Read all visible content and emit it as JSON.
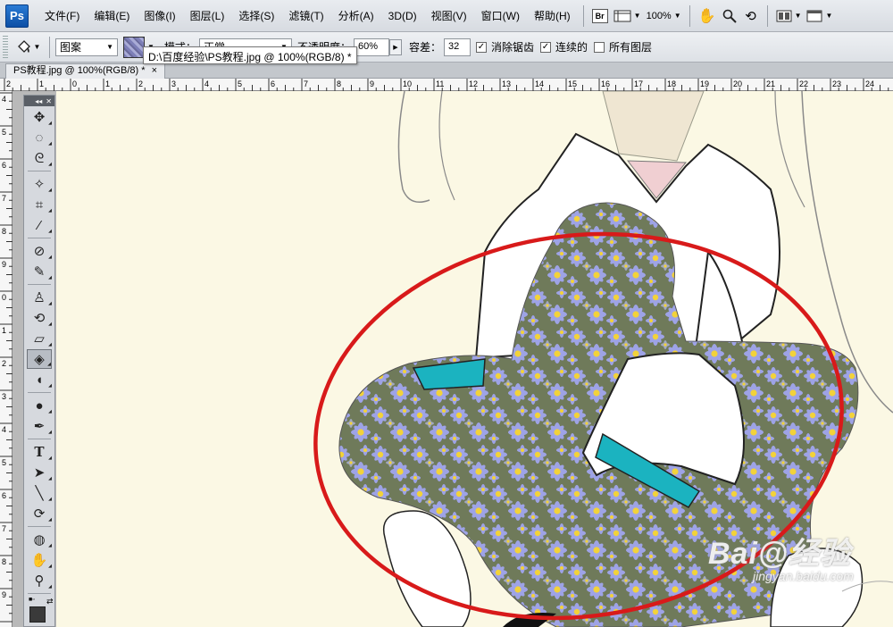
{
  "app": {
    "logo": "Ps"
  },
  "menu": {
    "items": [
      "文件(F)",
      "编辑(E)",
      "图像(I)",
      "图层(L)",
      "选择(S)",
      "滤镜(T)",
      "分析(A)",
      "3D(D)",
      "视图(V)",
      "窗口(W)",
      "帮助(H)"
    ]
  },
  "appbar": {
    "bridge_label": "Br",
    "zoom": "100%"
  },
  "options": {
    "fill_source": "图案",
    "mode_label": "模式：",
    "mode_value": "正常",
    "opacity_label": "不透明度：",
    "opacity_value": "60%",
    "tolerance_label": "容差：",
    "tolerance_value": "32",
    "antialias": {
      "label": "消除锯齿",
      "checked": true
    },
    "contiguous": {
      "label": "连续的",
      "checked": true
    },
    "all_layers": {
      "label": "所有图层",
      "checked": false
    }
  },
  "tooltip": "D:\\百度经验\\PS教程.jpg @ 100%(RGB/8) *",
  "document": {
    "tab_title": "PS教程.jpg @ 100%(RGB/8) *",
    "close": "×"
  },
  "ruler": {
    "h_labels": [
      "2",
      "1",
      "0",
      "1",
      "2",
      "3",
      "4",
      "5",
      "6",
      "7",
      "8",
      "9",
      "10",
      "11",
      "12",
      "13",
      "14",
      "15",
      "16",
      "17",
      "18",
      "19",
      "20",
      "21",
      "22",
      "23",
      "24"
    ],
    "v_labels": [
      "4",
      "5",
      "6",
      "7",
      "8",
      "9",
      "0",
      "1",
      "2",
      "3",
      "4",
      "5",
      "6",
      "7",
      "8",
      "9"
    ]
  },
  "toolbox": {
    "tools": [
      "move-tool",
      "marquee-tool",
      "lasso-tool",
      "magic-wand-tool",
      "crop-tool",
      "eyedropper-tool",
      "healing-brush-tool",
      "brush-tool",
      "clone-stamp-tool",
      "history-brush-tool",
      "eraser-tool",
      "paint-bucket-tool",
      "blur-tool",
      "dodge-tool",
      "pen-tool",
      "type-tool",
      "path-selection-tool",
      "line-tool",
      "3d-rotate-tool",
      "3d-orbit-tool",
      "hand-tool",
      "zoom-tool"
    ],
    "active_tool": "paint-bucket-tool",
    "type_glyph": "T"
  },
  "colors": {
    "foreground": "#3a3a3a",
    "background": "#ffffff",
    "annotation_ellipse": "#d81a1a",
    "fabric_accent": "#1bb3c0"
  },
  "watermark": {
    "main": "Bai@经验",
    "sub": "jingyan.baidu.com"
  }
}
